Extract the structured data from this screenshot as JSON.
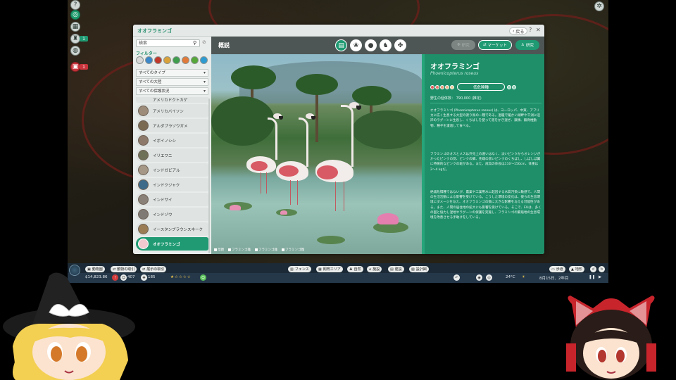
{
  "colors": {
    "accent": "#1f9a72",
    "info_bg": "#1e8f69",
    "status_red": "#e05a5a"
  },
  "side_badges": {
    "badge1": "1",
    "badge2": "1"
  },
  "window": {
    "title": "オオフラミンゴ",
    "back_label": "戻る",
    "help_icon": "?",
    "close_icon": "✕"
  },
  "left_panel": {
    "search_placeholder": "検索",
    "filter_label": "フィルター",
    "dropdowns": [
      "すべてのタイプ",
      "すべての大陸",
      "すべての保護状況"
    ],
    "animals": [
      "アメリカドクトカゲ",
      "アメリカバイソン",
      "アルダブラゾウガメ",
      "イボイノシシ",
      "イリエワニ",
      "インドガビアル",
      "インドクジャク",
      "インドサイ",
      "インドゾウ",
      "イースタンブラウンスネーク",
      "オオフラミンゴ"
    ]
  },
  "content": {
    "title": "概説",
    "tab_icons": [
      "clipboard-icon",
      "habitat-icon",
      "drop-icon",
      "family-icon",
      "paw-icon"
    ],
    "disabled_button": "研究",
    "market_button": "マーケット",
    "research_button": "研究"
  },
  "photo": {
    "captions": [
      "母親",
      "フラミンゴ雄",
      "フラミンゴ雌",
      "フラミンゴ雛"
    ]
  },
  "info": {
    "name": "オオフラミンゴ",
    "scientific": "Phoenicopterus roseus",
    "status_label": "低危険種",
    "wild_population": "野生の個体数： 790,000 (推定)",
    "paragraphs": [
      "オオフラミンゴ (Phoenicopterus roseus) は、ヨーロッパ、中東、アフリカに広く生息する大型の渡り鳥の一種である。温暖で暖かい湖畔や干潟に沿岸のラグーンに生息し、くちばしを使って泥をかき混ぜ、藻類、無脊椎動物、種子を濾過して食べる。",
      "フラミンゴのオスとメスは外見上の違いはなく、淡いピンクからオレンジがかったピンクの羽、ピンクの脚、先端の黒いピンクのくちばし、しばしば翼に特徴的なピンクの斑がある。また、成鳥の体長は110〜150cm、体重は2〜4 kgだ。",
      "絶滅危惧種ではないが、農業や工業用水に起因する水質汚染に敏感で、人間の生活活動による影響を受けている。こうした環境の変化は、彼らの生息環境にダメージを与え、オオフラミンゴの数に大きな影響を与える可能性がある。また、人間の居住地の拡大にも影響を受けている。そこで、EUは、多くの国と協力し湿地やラグーンの保護を実施し、フラミンゴの繁殖地の生息環境を改善させる手助けをしている。"
    ]
  },
  "bottom": {
    "buttons": [
      "動物園",
      "動物の取引",
      "展示の取引",
      "フェンス",
      "飼育エリア",
      "自然",
      "施設",
      "建設",
      "設計図",
      "歩道",
      "地形"
    ],
    "money": "$14,823.86",
    "guests": "407",
    "animals_count": "185",
    "temperature": "24°C",
    "date": "8月15日、2年目"
  }
}
